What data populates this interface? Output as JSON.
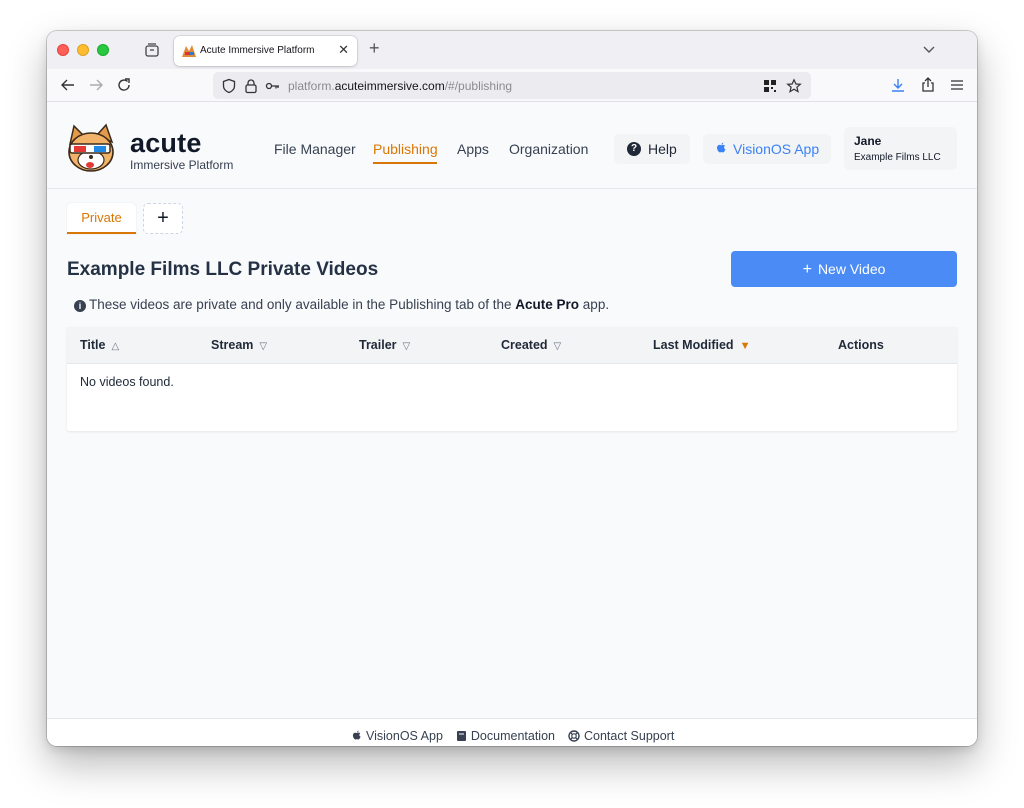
{
  "browser": {
    "tab_title": "Acute Immersive Platform",
    "url_prefix": "platform.",
    "url_domain": "acuteimmersive.com",
    "url_path": "/#/publishing"
  },
  "header": {
    "brand": "acute",
    "brand_sub": "Immersive Platform",
    "nav": [
      "File Manager",
      "Publishing",
      "Apps",
      "Organization"
    ],
    "active_nav": "Publishing",
    "help_label": "Help",
    "visionos_label": "VisionOS App",
    "user_name": "Jane",
    "user_org": "Example Films LLC"
  },
  "subtabs": {
    "private_label": "Private",
    "add_label": "+"
  },
  "main": {
    "title": "Example Films LLC Private Videos",
    "new_video_label": "New Video",
    "info_before": "These videos are private and only available in the Publishing tab of the ",
    "info_app": "Acute Pro",
    "info_after": " app."
  },
  "table": {
    "columns": [
      {
        "label": "Title",
        "sort": "△"
      },
      {
        "label": "Stream",
        "sort": "▽"
      },
      {
        "label": "Trailer",
        "sort": "▽"
      },
      {
        "label": "Created",
        "sort": "▽"
      },
      {
        "label": "Last Modified",
        "sort": "▼"
      },
      {
        "label": "Actions",
        "sort": ""
      }
    ],
    "empty_message": "No videos found."
  },
  "footer": {
    "links": [
      "VisionOS App",
      "Documentation",
      "Contact Support"
    ]
  },
  "colors": {
    "accent": "#d97706",
    "primary_button": "#4b8bf5",
    "link_blue": "#3b82f6"
  }
}
